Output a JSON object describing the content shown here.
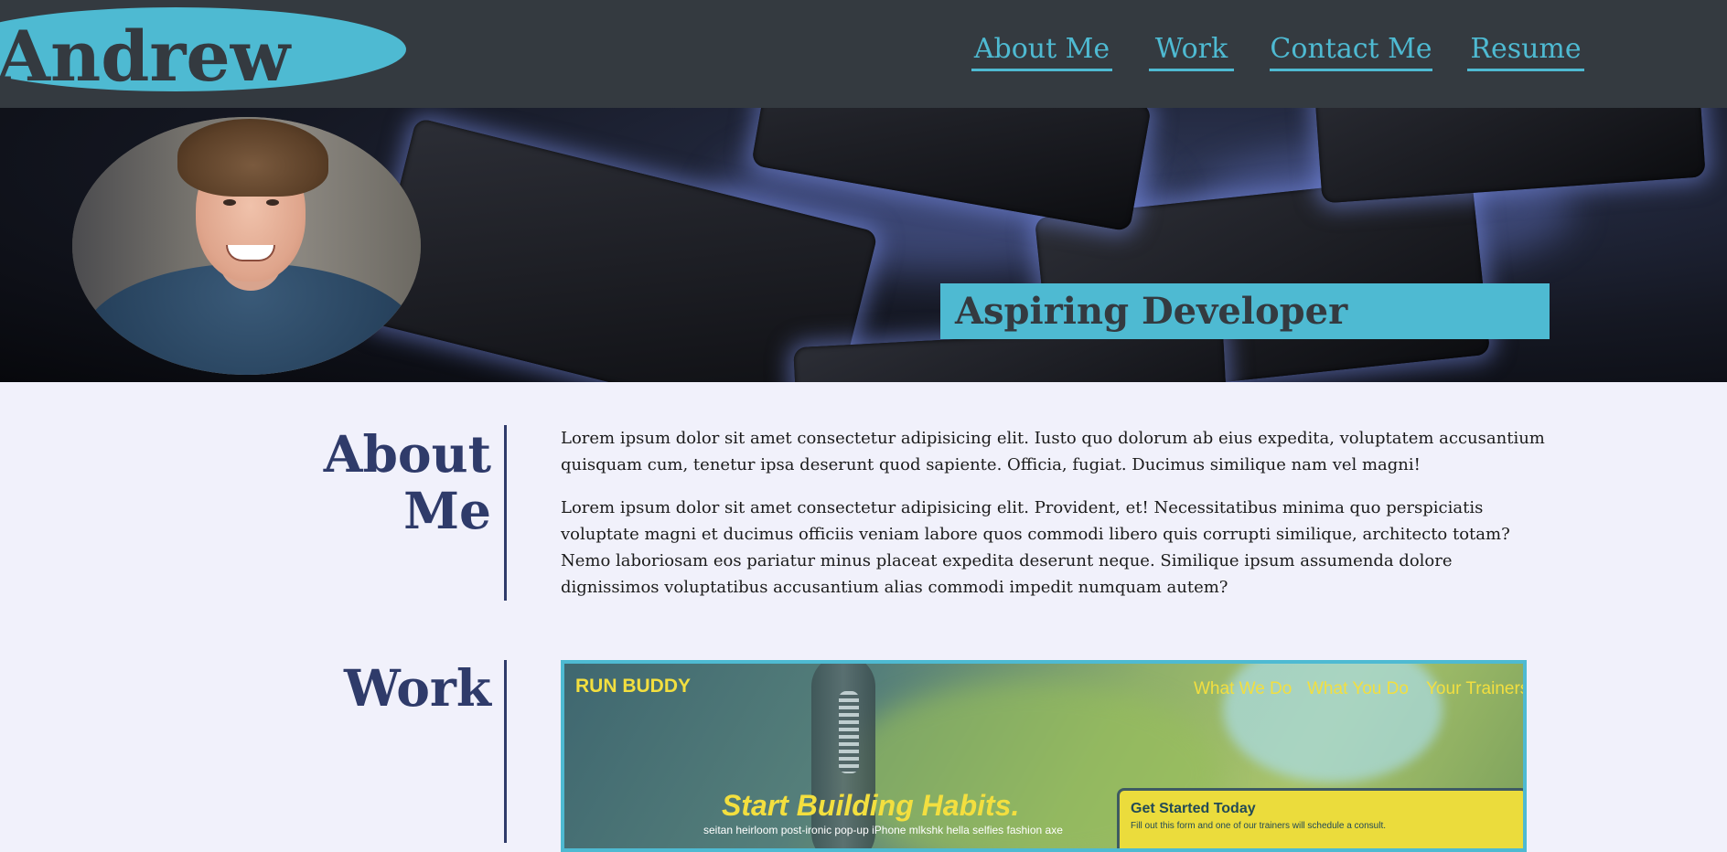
{
  "header": {
    "brand": "Andrew",
    "nav": [
      "About Me",
      "Work",
      "Contact Me",
      "Resume"
    ]
  },
  "hero": {
    "tagline": "Aspiring Developer"
  },
  "about": {
    "title_line1": "About",
    "title_line2": "Me",
    "paragraphs": [
      "Lorem ipsum dolor sit amet consectetur adipisicing elit. Iusto quo dolorum ab eius expedita, voluptatem accusantium quisquam cum, tenetur ipsa deserunt quod sapiente. Officia, fugiat. Ducimus similique nam vel magni!",
      "Lorem ipsum dolor sit amet consectetur adipisicing elit. Provident, et! Necessitatibus minima quo perspiciatis voluptate magni et ducimus officiis veniam labore quos commodi libero quis corrupti similique, architecto totam? Nemo laboriosam eos pariatur minus placeat expedita deserunt neque. Similique ipsum assumenda dolore dignissimos voluptatibus accusantium alias commodi impedit numquam autem?"
    ]
  },
  "work": {
    "title": "Work",
    "project": {
      "logo": "RUN BUDDY",
      "nav": [
        "What We Do",
        "What You Do",
        "Your Trainers"
      ],
      "headline": "Start Building Habits.",
      "subline": "seitan heirloom post-ironic pop-up iPhone mlkshk hella selfies fashion axe",
      "form_title": "Get Started Today",
      "form_text": "Fill out this form and one of our trainers will schedule a consult."
    }
  },
  "colors": {
    "header_bg": "#343a40",
    "accent": "#4ebad2",
    "page_bg": "#f1f1fb",
    "heading": "#2f3b6a"
  }
}
